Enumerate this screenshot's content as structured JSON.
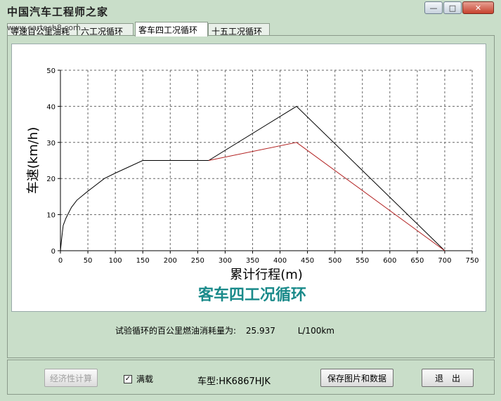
{
  "window": {
    "title": "中国汽车工程师之家",
    "url_watermark": "www.cartech8.com",
    "controls": {
      "minimize": "—",
      "maximize": "□",
      "close": "✕"
    }
  },
  "tabs": [
    {
      "label": "等速百公里油耗"
    },
    {
      "label": "六工况循环"
    },
    {
      "label": "客车四工况循环",
      "active": true
    },
    {
      "label": "十五工况循环"
    }
  ],
  "chart_data": {
    "type": "line",
    "title": "客车四工况循环",
    "xlabel": "累计行程(m)",
    "ylabel": "车速(km/h)",
    "xlim": [
      0,
      750
    ],
    "ylim": [
      0,
      50
    ],
    "xticks": [
      0,
      50,
      100,
      150,
      200,
      250,
      300,
      350,
      400,
      450,
      500,
      550,
      600,
      650,
      700,
      750
    ],
    "yticks": [
      0,
      10,
      20,
      30,
      40,
      50
    ],
    "grid": true,
    "series": [
      {
        "color": "#000000",
        "x": [
          0,
          2,
          5,
          10,
          20,
          30,
          50,
          80,
          100,
          150,
          270,
          430,
          700
        ],
        "y": [
          0,
          3,
          7,
          9,
          12,
          14,
          16.5,
          20,
          21.5,
          25,
          25,
          40,
          0
        ]
      },
      {
        "color": "#b22222",
        "x": [
          270,
          430,
          700
        ],
        "y": [
          25,
          30,
          0
        ]
      }
    ]
  },
  "result": {
    "label": "试验循环的百公里燃油消耗量为:",
    "value": "25.937",
    "unit": "L/100km"
  },
  "bottom": {
    "economy_button": "经济性计算",
    "full_load_label": "满载",
    "full_load_checked": "✓",
    "model_label": "车型:HK6867HJK",
    "save_button": "保存图片和数据",
    "exit_button": "退　出"
  },
  "colors": {
    "background": "#c9dec9",
    "title_teal": "#1a8a8a",
    "series_black": "#000000",
    "series_red": "#b22222"
  }
}
